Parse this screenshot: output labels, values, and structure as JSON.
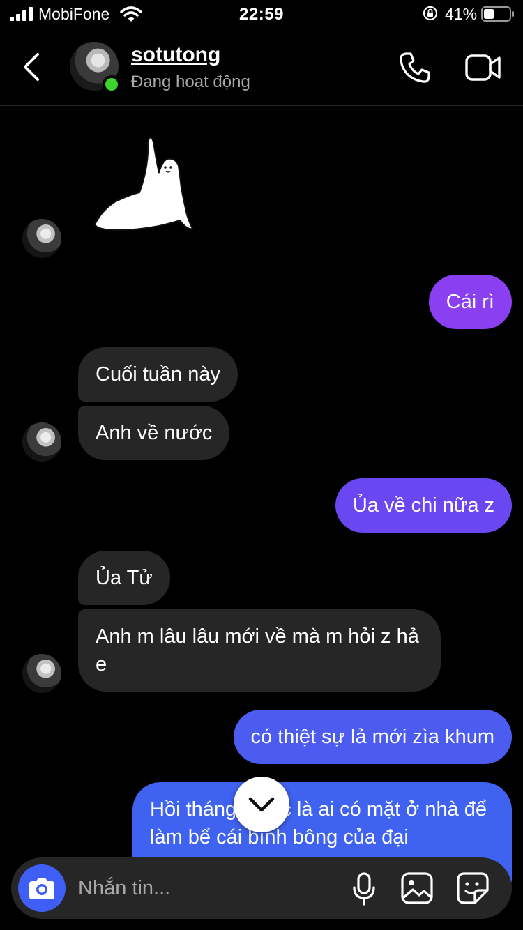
{
  "status_bar": {
    "carrier": "MobiFone",
    "time": "22:59",
    "battery_percent": "41%",
    "battery_level": 0.41
  },
  "header": {
    "username": "sotutong",
    "status": "Đang hoạt động"
  },
  "messages": [
    {
      "from": "them",
      "type": "sticker",
      "sticker": "waving-seal-sticker"
    },
    {
      "from": "me",
      "text": "Cái rì"
    },
    {
      "from": "them",
      "text": "Cuối tuần này"
    },
    {
      "from": "them",
      "text": "Anh về nước"
    },
    {
      "from": "me",
      "text": "Ủa về chi nữa z"
    },
    {
      "from": "them",
      "text": "Ủa Tử"
    },
    {
      "from": "them",
      "text": "Anh m lâu lâu mới về mà m hỏi z hả e"
    },
    {
      "from": "me",
      "text": "có thiệt sự lả mới zìa khum"
    },
    {
      "from": "me",
      "text": "Hồi tháng trước là ai có mặt ở nhà để làm bể cái bình bông của đại"
    }
  ],
  "composer": {
    "placeholder": "Nhắn tin..."
  },
  "colors": {
    "background": "#000000",
    "incoming_bubble": "#262626",
    "outgoing_gradient": [
      "#8a3ff0",
      "#3f63f0"
    ],
    "online_dot": "#3cd52e",
    "camera_button": "#3f5ef5"
  }
}
